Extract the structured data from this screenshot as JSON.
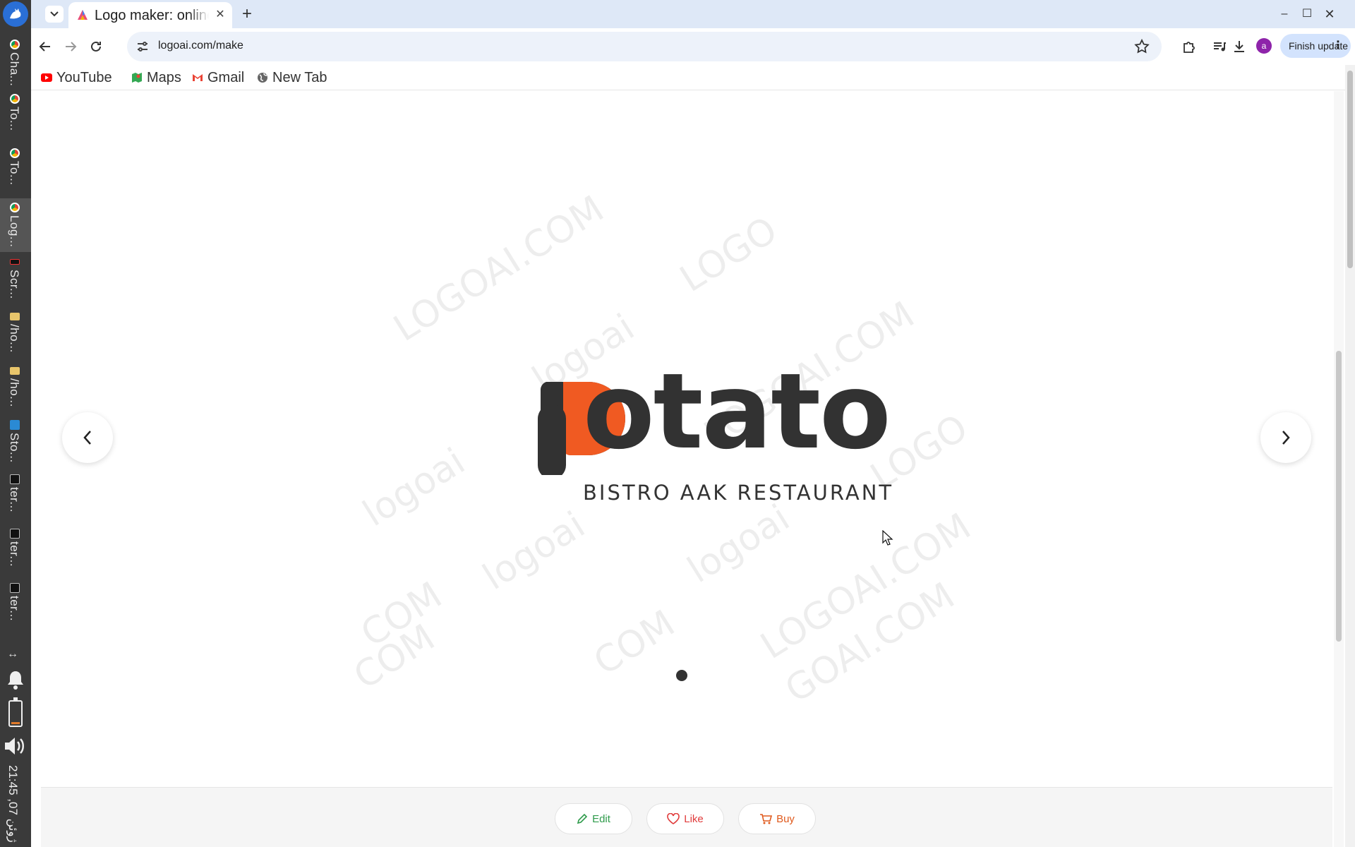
{
  "taskbar": {
    "items": [
      {
        "label": "Cha...",
        "icon": "chrome-icon"
      },
      {
        "label": "To...",
        "icon": "chrome-icon"
      },
      {
        "label": "To...",
        "icon": "chrome-icon"
      },
      {
        "label": "Log...",
        "icon": "chrome-icon",
        "active": true
      },
      {
        "label": "Scr...",
        "icon": "screenshot-icon"
      },
      {
        "label": "/ho...",
        "icon": "folder-icon"
      },
      {
        "label": "/ho...",
        "icon": "folder-icon"
      },
      {
        "label": "Sto...",
        "icon": "vscode-icon"
      },
      {
        "label": "ter...",
        "icon": "terminal-icon"
      },
      {
        "label": "ter...",
        "icon": "terminal-icon"
      },
      {
        "label": "ter...",
        "icon": "terminal-icon"
      }
    ],
    "tray_arrows": "↔",
    "clock": "21:45 ,ژوئن 07"
  },
  "browser": {
    "tab_title": "Logo maker: online",
    "tab_close": "✕",
    "new_tab": "+",
    "window_controls": {
      "minimize": "–",
      "maximize": "☐",
      "close": "✕"
    },
    "url": "logoai.com/make",
    "profile_initial": "a",
    "finish_update": "Finish update",
    "bookmarks": [
      {
        "label": "YouTube",
        "icon": "youtube-icon"
      },
      {
        "label": "Maps",
        "icon": "maps-icon"
      },
      {
        "label": "Gmail",
        "icon": "gmail-icon"
      },
      {
        "label": "New Tab",
        "icon": "globe-icon"
      }
    ]
  },
  "logo": {
    "wordmark": "otato",
    "tagline": "BISTRO AAK RESTAURANT",
    "mark_color": "#f05a22",
    "text_color": "#323232"
  },
  "watermark": {
    "texts": [
      "LOGOAI.COM",
      "LOGO",
      "logoai",
      "LOGOAI.COM",
      "logoai",
      "LOGO",
      "COM",
      "logoai",
      "logoai",
      "LOGOAI.COM",
      "COM",
      "COM",
      "GOAI.COM"
    ]
  },
  "actions": {
    "edit": "Edit",
    "like": "Like",
    "buy": "Buy"
  },
  "colors": {
    "accent_green": "#2e9b4b",
    "accent_red": "#e03b3b",
    "accent_orange": "#e05a1d"
  }
}
